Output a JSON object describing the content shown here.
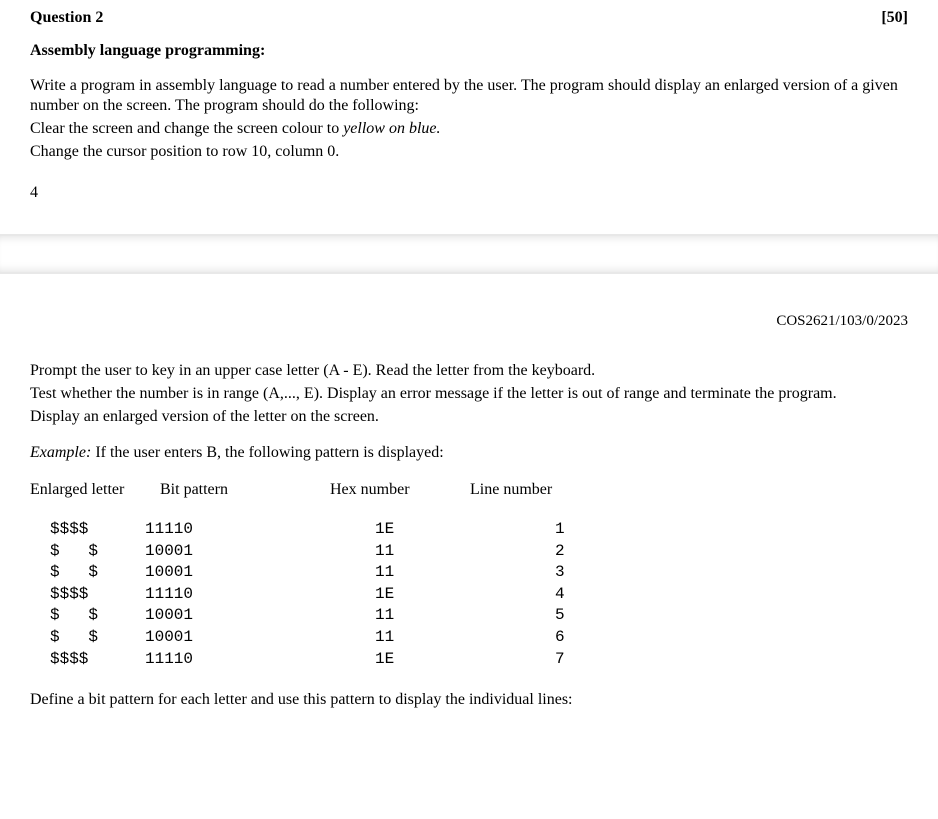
{
  "header": {
    "question_label": "Question 2",
    "marks": "[50]"
  },
  "subtitle": "Assembly language programming:",
  "intro": {
    "p1": "Write a program in assembly language to read a number entered by the user. The program should display an enlarged version of a given number on the screen. The program should do the following:",
    "p2a": "Clear the screen and change the screen colour to ",
    "p2b": "yellow on blue.",
    "p3": "Change the cursor position to row 10, column 0."
  },
  "page_number": "4",
  "doc_code": "COS2621/103/0/2023",
  "instructions": {
    "p1": "Prompt the user to key in an upper case letter (A - E). Read the letter from the keyboard.",
    "p2": "Test whether the number is in range (A,..., E). Display an error message if the letter is out of range and terminate the program.",
    "p3": "Display an enlarged version of the letter on the screen."
  },
  "example_intro_a": "Example:",
  "example_intro_b": " If the user enters B, the following pattern is displayed:",
  "table_headings": {
    "h1": "Enlarged letter",
    "h2": "Bit pattern",
    "h3": "Hex number",
    "h4": "Line number"
  },
  "table_rows": [
    {
      "enlarged": "$$$$ ",
      "bit": "11110",
      "hex": "1E",
      "line": "1"
    },
    {
      "enlarged": "$   $",
      "bit": "10001",
      "hex": "11",
      "line": "2"
    },
    {
      "enlarged": "$   $",
      "bit": "10001",
      "hex": "11",
      "line": "3"
    },
    {
      "enlarged": "$$$$ ",
      "bit": "11110",
      "hex": "1E",
      "line": "4"
    },
    {
      "enlarged": "$   $",
      "bit": "10001",
      "hex": "11",
      "line": "5"
    },
    {
      "enlarged": "$   $",
      "bit": "10001",
      "hex": "11",
      "line": "6"
    },
    {
      "enlarged": "$$$$ ",
      "bit": "11110",
      "hex": "1E",
      "line": "7"
    }
  ],
  "footer_note": "Define a bit pattern for each letter and use this pattern to display the individual lines:"
}
